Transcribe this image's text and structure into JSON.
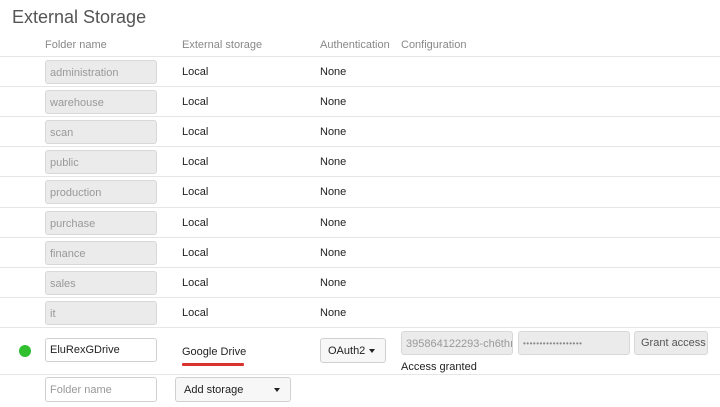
{
  "title": "External Storage",
  "columns": {
    "folder_name": "Folder name",
    "external_storage": "External storage",
    "authentication": "Authentication",
    "configuration": "Configuration"
  },
  "mounts": [
    {
      "folder": "administration",
      "storage": "Local",
      "auth": "None"
    },
    {
      "folder": "warehouse",
      "storage": "Local",
      "auth": "None"
    },
    {
      "folder": "scan",
      "storage": "Local",
      "auth": "None"
    },
    {
      "folder": "public",
      "storage": "Local",
      "auth": "None"
    },
    {
      "folder": "production",
      "storage": "Local",
      "auth": "None"
    },
    {
      "folder": "purchase",
      "storage": "Local",
      "auth": "None"
    },
    {
      "folder": "finance",
      "storage": "Local",
      "auth": "None"
    },
    {
      "folder": "sales",
      "storage": "Local",
      "auth": "None"
    },
    {
      "folder": "it",
      "storage": "Local",
      "auth": "None"
    }
  ],
  "google_drive": {
    "status_color": "#2fbf2f",
    "folder": "EluRexGDrive",
    "storage": "Google Drive",
    "auth": "OAuth2",
    "client_id": "395864122293-ch6thı",
    "client_secret": "••••••••••••••••••",
    "grant_label": "Grant access",
    "status_text": "Access granted",
    "underline_color": "#d9332f"
  },
  "new_mount": {
    "folder_placeholder": "Folder name",
    "add_storage_label": "Add storage"
  }
}
